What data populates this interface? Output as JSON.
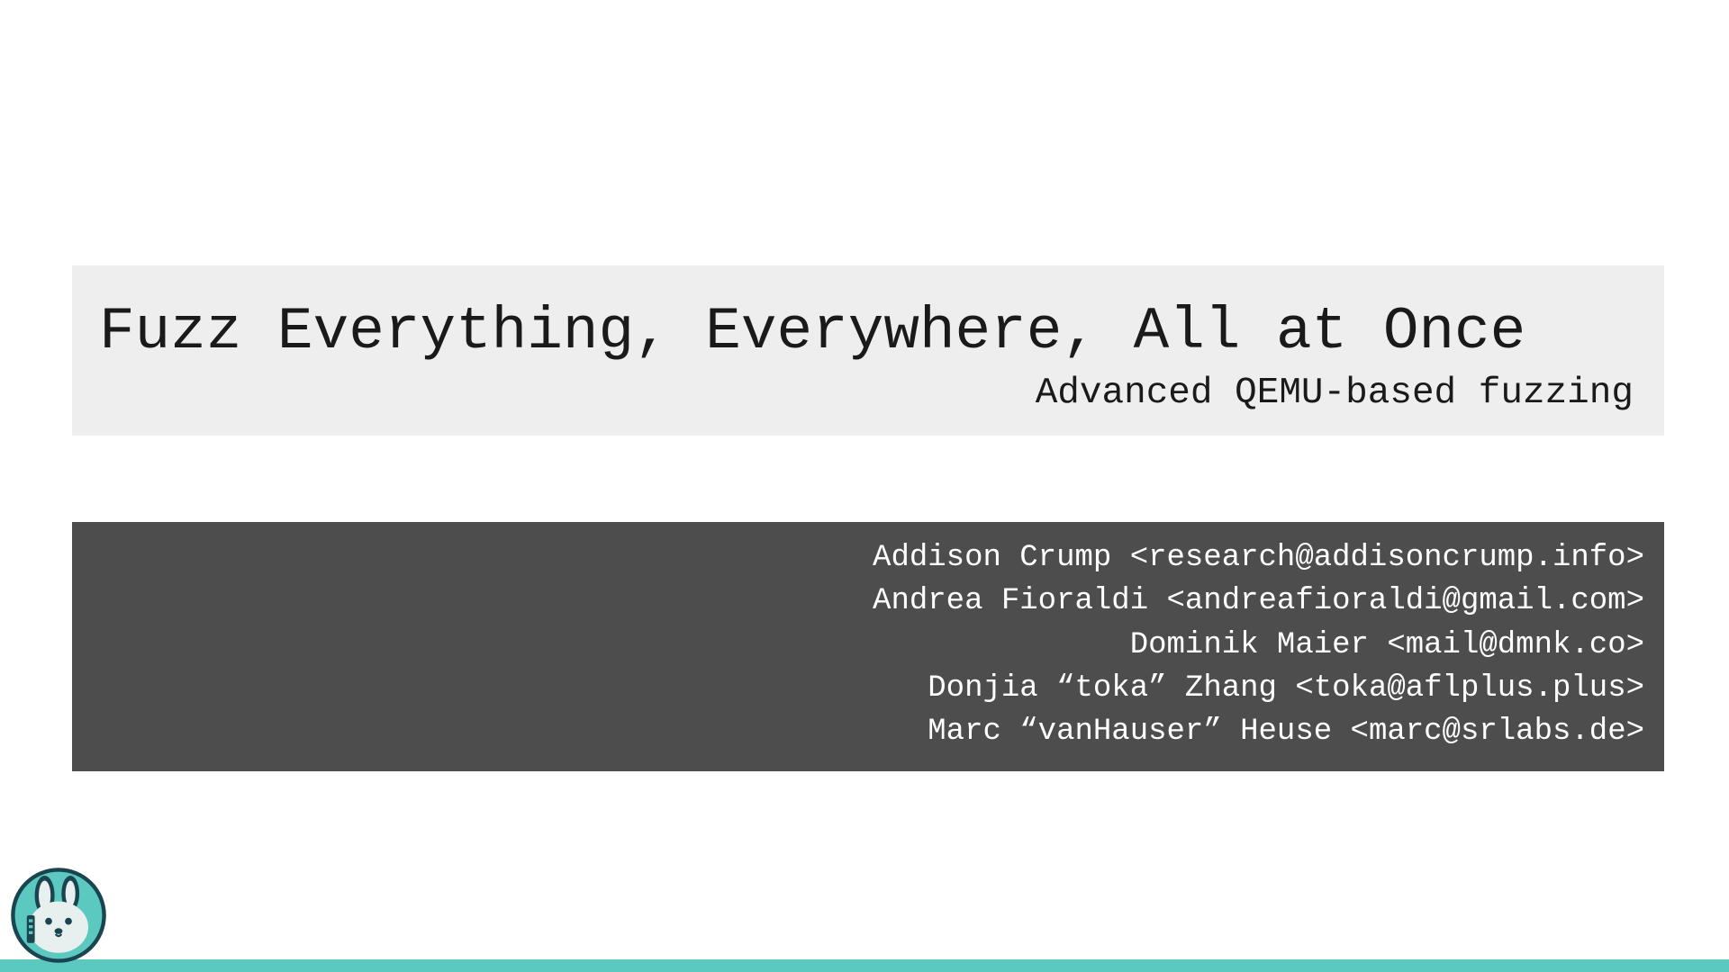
{
  "title_block": {
    "title": "Fuzz Everything, Everywhere, All at Once",
    "subtitle": "Advanced QEMU-based fuzzing"
  },
  "authors": [
    "Addison Crump <research@addisoncrump.info>",
    "Andrea Fioraldi <andreafioraldi@gmail.com>",
    "Dominik Maier <mail@dmnk.co>",
    "Donjia “toka” Zhang <toka@aflplus.plus>",
    "Marc “vanHauser” Heuse <marc@srlabs.de>"
  ],
  "colors": {
    "title_bg": "#eeeeee",
    "authors_bg": "#4d4d4d",
    "accent": "#5cc9c1",
    "logo_dark": "#1a4550",
    "logo_light": "#e8f0ef"
  },
  "logo_name": "bunny-mascot-icon"
}
